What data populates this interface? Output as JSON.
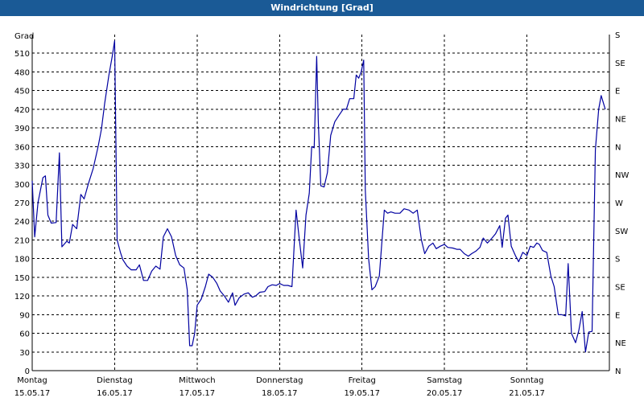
{
  "window": {
    "title": "Windrichtung [Grad]"
  },
  "chart_data": {
    "type": "line",
    "title": "Windrichtung [Grad]",
    "ylabel": "Grad",
    "ylim": [
      0,
      540
    ],
    "xlim": [
      0,
      7
    ],
    "grid": true,
    "y_ticks": [
      0,
      30,
      60,
      90,
      120,
      150,
      180,
      210,
      240,
      270,
      300,
      330,
      360,
      390,
      420,
      450,
      480,
      510
    ],
    "right_axis_labels": [
      "N",
      "NE",
      "E",
      "SE",
      "S",
      "SW",
      "W",
      "NW",
      "N",
      "NE",
      "E",
      "SE",
      "S"
    ],
    "x_ticks": [
      {
        "day": "Montag",
        "date": "15.05.17",
        "x": 0
      },
      {
        "day": "Dienstag",
        "date": "16.05.17",
        "x": 1
      },
      {
        "day": "Mittwoch",
        "date": "17.05.17",
        "x": 2
      },
      {
        "day": "Donnerstag",
        "date": "18.05.17",
        "x": 3
      },
      {
        "day": "Freitag",
        "date": "19.05.17",
        "x": 4
      },
      {
        "day": "Samstag",
        "date": "20.05.17",
        "x": 5
      },
      {
        "day": "Sonntag",
        "date": "21.05.17",
        "x": 6
      }
    ],
    "colors": {
      "line": "#0000a0",
      "titlebar": "#1a5a96",
      "grid": "#000000"
    },
    "series": [
      {
        "points": [
          [
            0.0,
            305
          ],
          [
            0.03,
            215
          ],
          [
            0.07,
            270
          ],
          [
            0.13,
            310
          ],
          [
            0.16,
            313
          ],
          [
            0.19,
            250
          ],
          [
            0.23,
            237
          ],
          [
            0.29,
            238
          ],
          [
            0.33,
            350
          ],
          [
            0.36,
            199
          ],
          [
            0.42,
            208
          ],
          [
            0.45,
            205
          ],
          [
            0.49,
            235
          ],
          [
            0.54,
            228
          ],
          [
            0.59,
            283
          ],
          [
            0.63,
            276
          ],
          [
            0.68,
            300
          ],
          [
            0.74,
            325
          ],
          [
            0.8,
            360
          ],
          [
            0.84,
            388
          ],
          [
            0.88,
            430
          ],
          [
            0.93,
            475
          ],
          [
            0.97,
            505
          ],
          [
            1.0,
            530
          ],
          [
            1.03,
            210
          ],
          [
            1.07,
            190
          ],
          [
            1.1,
            178
          ],
          [
            1.15,
            168
          ],
          [
            1.2,
            162
          ],
          [
            1.26,
            162
          ],
          [
            1.3,
            170
          ],
          [
            1.35,
            145
          ],
          [
            1.4,
            145
          ],
          [
            1.45,
            160
          ],
          [
            1.5,
            168
          ],
          [
            1.55,
            163
          ],
          [
            1.59,
            215
          ],
          [
            1.64,
            228
          ],
          [
            1.69,
            215
          ],
          [
            1.74,
            185
          ],
          [
            1.79,
            170
          ],
          [
            1.84,
            165
          ],
          [
            1.88,
            130
          ],
          [
            1.91,
            40
          ],
          [
            1.94,
            40
          ],
          [
            1.97,
            60
          ],
          [
            2.0,
            105
          ],
          [
            2.05,
            115
          ],
          [
            2.1,
            135
          ],
          [
            2.14,
            155
          ],
          [
            2.19,
            150
          ],
          [
            2.24,
            140
          ],
          [
            2.28,
            128
          ],
          [
            2.33,
            120
          ],
          [
            2.38,
            110
          ],
          [
            2.43,
            125
          ],
          [
            2.46,
            105
          ],
          [
            2.51,
            117
          ],
          [
            2.57,
            123
          ],
          [
            2.62,
            125
          ],
          [
            2.67,
            118
          ],
          [
            2.71,
            120
          ],
          [
            2.76,
            126
          ],
          [
            2.82,
            127
          ],
          [
            2.86,
            135
          ],
          [
            2.91,
            138
          ],
          [
            2.96,
            137
          ],
          [
            3.0,
            140
          ],
          [
            3.05,
            137
          ],
          [
            3.1,
            137
          ],
          [
            3.15,
            135
          ],
          [
            3.2,
            258
          ],
          [
            3.24,
            210
          ],
          [
            3.28,
            165
          ],
          [
            3.32,
            250
          ],
          [
            3.36,
            285
          ],
          [
            3.39,
            360
          ],
          [
            3.42,
            358
          ],
          [
            3.45,
            505
          ],
          [
            3.47,
            400
          ],
          [
            3.5,
            297
          ],
          [
            3.54,
            295
          ],
          [
            3.58,
            318
          ],
          [
            3.62,
            378
          ],
          [
            3.67,
            400
          ],
          [
            3.72,
            410
          ],
          [
            3.77,
            420
          ],
          [
            3.81,
            420
          ],
          [
            3.85,
            437
          ],
          [
            3.9,
            437
          ],
          [
            3.93,
            475
          ],
          [
            3.96,
            470
          ],
          [
            3.99,
            480
          ],
          [
            4.02,
            499
          ],
          [
            4.04,
            290
          ],
          [
            4.08,
            180
          ],
          [
            4.12,
            130
          ],
          [
            4.16,
            135
          ],
          [
            4.21,
            152
          ],
          [
            4.27,
            258
          ],
          [
            4.31,
            253
          ],
          [
            4.35,
            255
          ],
          [
            4.4,
            253
          ],
          [
            4.46,
            253
          ],
          [
            4.51,
            260
          ],
          [
            4.57,
            258
          ],
          [
            4.62,
            253
          ],
          [
            4.67,
            258
          ],
          [
            4.72,
            210
          ],
          [
            4.76,
            188
          ],
          [
            4.81,
            200
          ],
          [
            4.86,
            205
          ],
          [
            4.9,
            196
          ],
          [
            4.95,
            200
          ],
          [
            5.0,
            203
          ],
          [
            5.04,
            198
          ],
          [
            5.1,
            197
          ],
          [
            5.15,
            195
          ],
          [
            5.19,
            195
          ],
          [
            5.24,
            188
          ],
          [
            5.29,
            184
          ],
          [
            5.33,
            188
          ],
          [
            5.38,
            192
          ],
          [
            5.43,
            198
          ],
          [
            5.47,
            213
          ],
          [
            5.52,
            205
          ],
          [
            5.57,
            212
          ],
          [
            5.62,
            220
          ],
          [
            5.67,
            233
          ],
          [
            5.7,
            198
          ],
          [
            5.74,
            245
          ],
          [
            5.77,
            250
          ],
          [
            5.81,
            200
          ],
          [
            5.86,
            185
          ],
          [
            5.9,
            175
          ],
          [
            5.95,
            190
          ],
          [
            6.0,
            185
          ],
          [
            6.04,
            200
          ],
          [
            6.08,
            198
          ],
          [
            6.12,
            205
          ],
          [
            6.15,
            203
          ],
          [
            6.19,
            193
          ],
          [
            6.24,
            190
          ],
          [
            6.29,
            152
          ],
          [
            6.33,
            135
          ],
          [
            6.38,
            90
          ],
          [
            6.42,
            90
          ],
          [
            6.47,
            88
          ],
          [
            6.5,
            172
          ],
          [
            6.54,
            60
          ],
          [
            6.59,
            45
          ],
          [
            6.63,
            65
          ],
          [
            6.67,
            95
          ],
          [
            6.71,
            30
          ],
          [
            6.75,
            62
          ],
          [
            6.79,
            63
          ],
          [
            6.83,
            355
          ],
          [
            6.87,
            420
          ],
          [
            6.9,
            442
          ],
          [
            6.95,
            420
          ]
        ]
      }
    ]
  }
}
